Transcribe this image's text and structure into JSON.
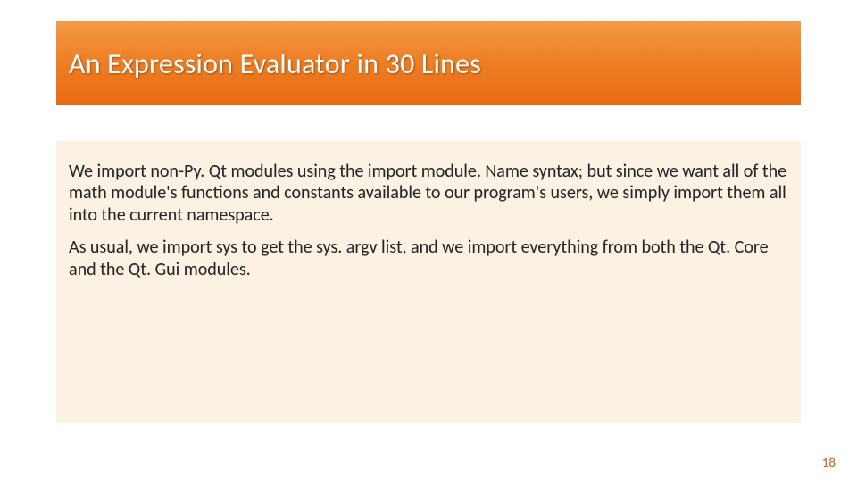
{
  "slide": {
    "title": "An Expression Evaluator in 30 Lines",
    "paragraphs": [
      "We import non-Py. Qt modules using the import module. Name syntax; but since we want all of the math module's functions and constants available to our program's users, we simply import them all into the current namespace.",
      "As usual, we import sys to get the sys. argv list, and we import everything from both the Qt. Core and the Qt. Gui modules."
    ],
    "page_number": "18"
  }
}
